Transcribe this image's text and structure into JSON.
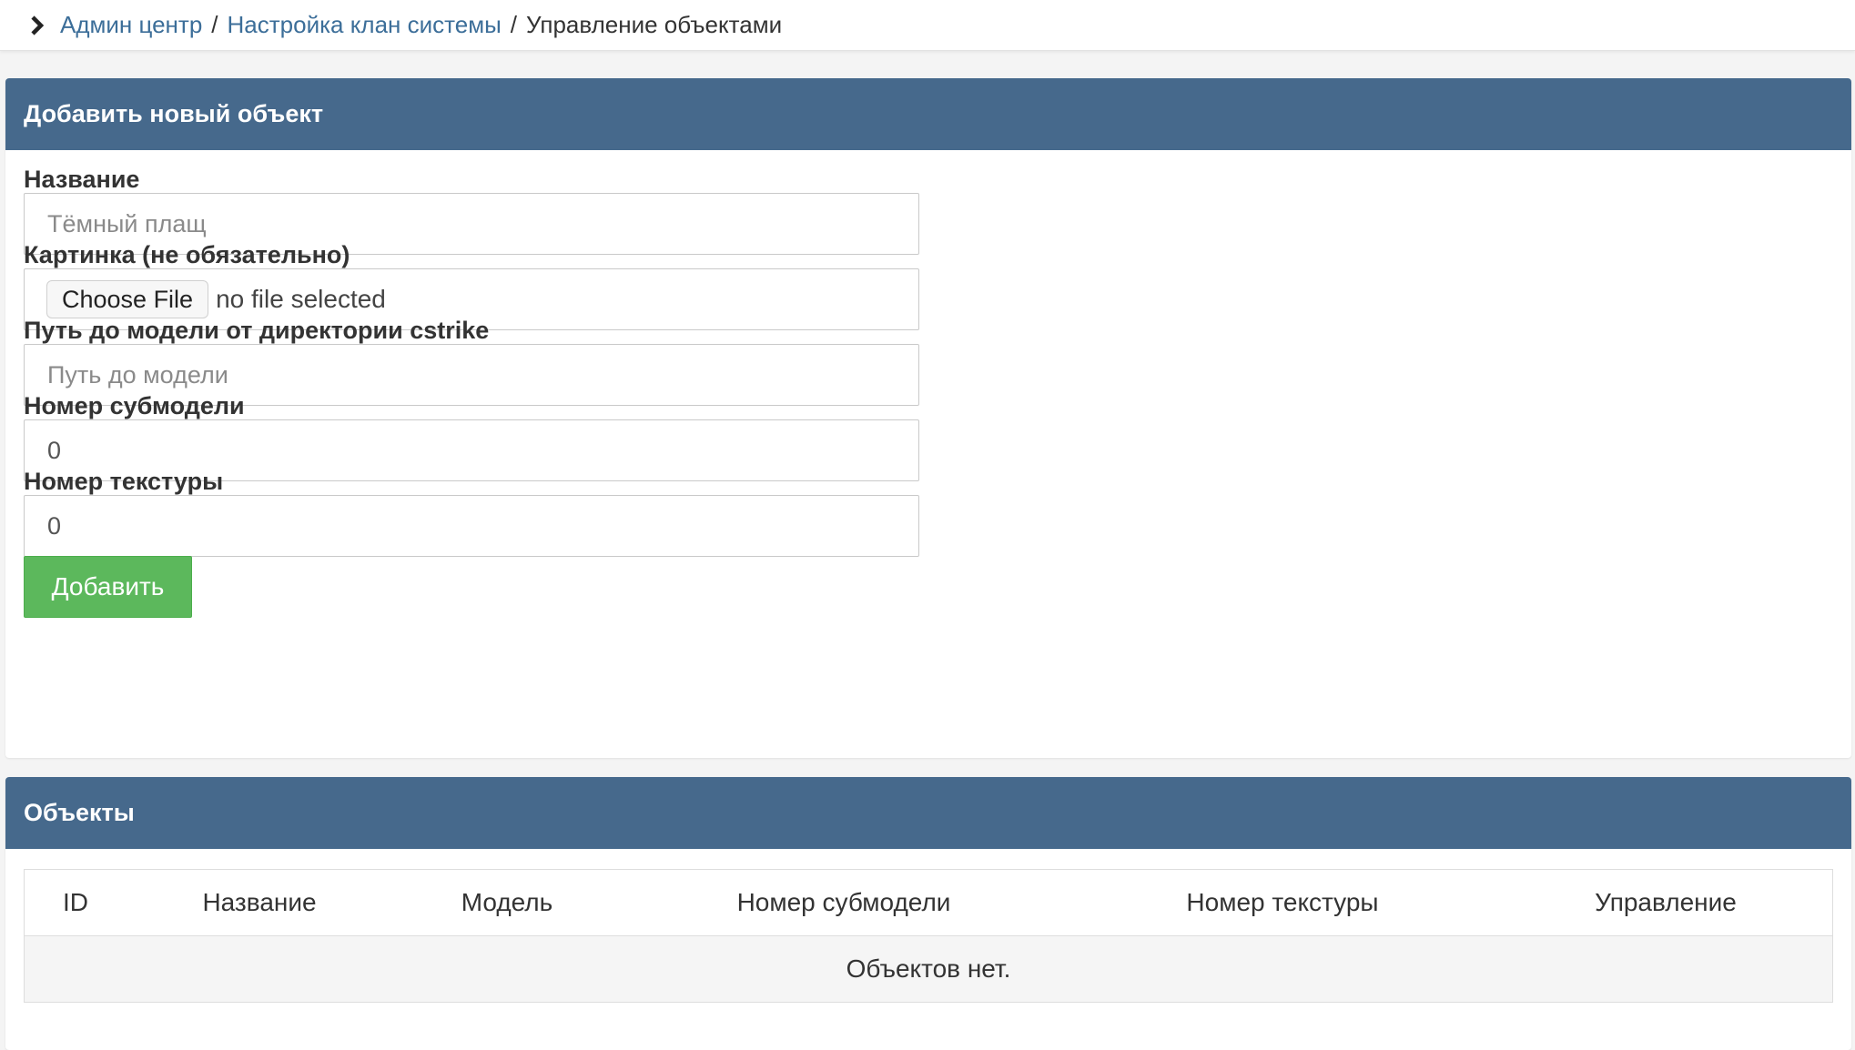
{
  "breadcrumb": {
    "items": [
      {
        "label": "Админ центр"
      },
      {
        "label": "Настройка клан системы"
      }
    ],
    "separator": "/",
    "current": "Управление объектами"
  },
  "add_panel": {
    "title": "Добавить новый объект",
    "fields": {
      "name": {
        "label": "Название",
        "placeholder": "Тёмный плащ"
      },
      "image": {
        "label": "Картинка (не обязательно)",
        "button": "Choose File",
        "status": "no file selected"
      },
      "model_path": {
        "label": "Путь до модели от директории cstrike",
        "placeholder": "Путь до модели"
      },
      "submodel": {
        "label": "Номер субмодели",
        "value": "0"
      },
      "texture": {
        "label": "Номер текстуры",
        "value": "0"
      }
    },
    "submit_label": "Добавить",
    "submit_color": "#5cb85c"
  },
  "objects_panel": {
    "title": "Объекты",
    "columns": [
      "ID",
      "Название",
      "Модель",
      "Номер субмодели",
      "Номер текстуры",
      "Управление"
    ],
    "empty_text": "Объектов нет."
  },
  "colors": {
    "panel_header": "#46698c",
    "link": "#3c6e99"
  },
  "icons": {
    "breadcrumb": "chevron-right-icon"
  }
}
